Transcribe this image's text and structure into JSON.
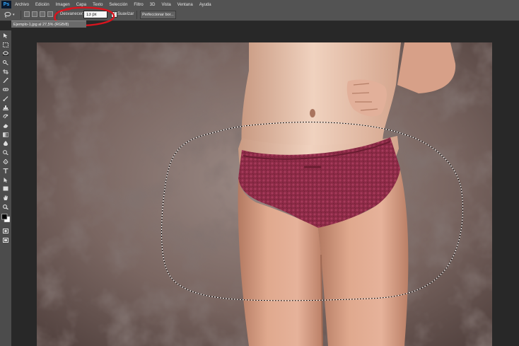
{
  "app": {
    "logo": "Ps"
  },
  "menubar": {
    "items": [
      "Archivo",
      "Edición",
      "Imagen",
      "Capa",
      "Texto",
      "Selección",
      "Filtro",
      "3D",
      "Vista",
      "Ventana",
      "Ayuda"
    ]
  },
  "options": {
    "feather_label": "Desvanecer:",
    "feather_value": "13 px",
    "antialias_label": "Suavizar",
    "antialias_checked": true,
    "refine_edge_label": "Perfeccionar bor...",
    "annotation_color": "#d9141e"
  },
  "document": {
    "tab_title": "Ejemplo-1.jpg al 27,5% (RGB/8)"
  },
  "toolbar": {
    "tools": [
      "move-tool",
      "marquee-tool",
      "lasso-tool",
      "quick-select-tool",
      "crop-tool",
      "eyedropper-tool",
      "healing-brush-tool",
      "brush-tool",
      "clone-stamp-tool",
      "history-brush-tool",
      "eraser-tool",
      "gradient-tool",
      "blur-tool",
      "dodge-tool",
      "pen-tool",
      "type-tool",
      "path-select-tool",
      "rectangle-tool",
      "hand-tool",
      "zoom-tool",
      "color-swatches",
      "quick-mask-tool",
      "screen-mode-tool"
    ],
    "foreground_color": "#000000",
    "background_color": "#ffffff"
  },
  "colors": {
    "ui_panel": "#535353",
    "canvas_background": "#786460",
    "garment": "#8a2a45",
    "skin": "#d9a185"
  }
}
